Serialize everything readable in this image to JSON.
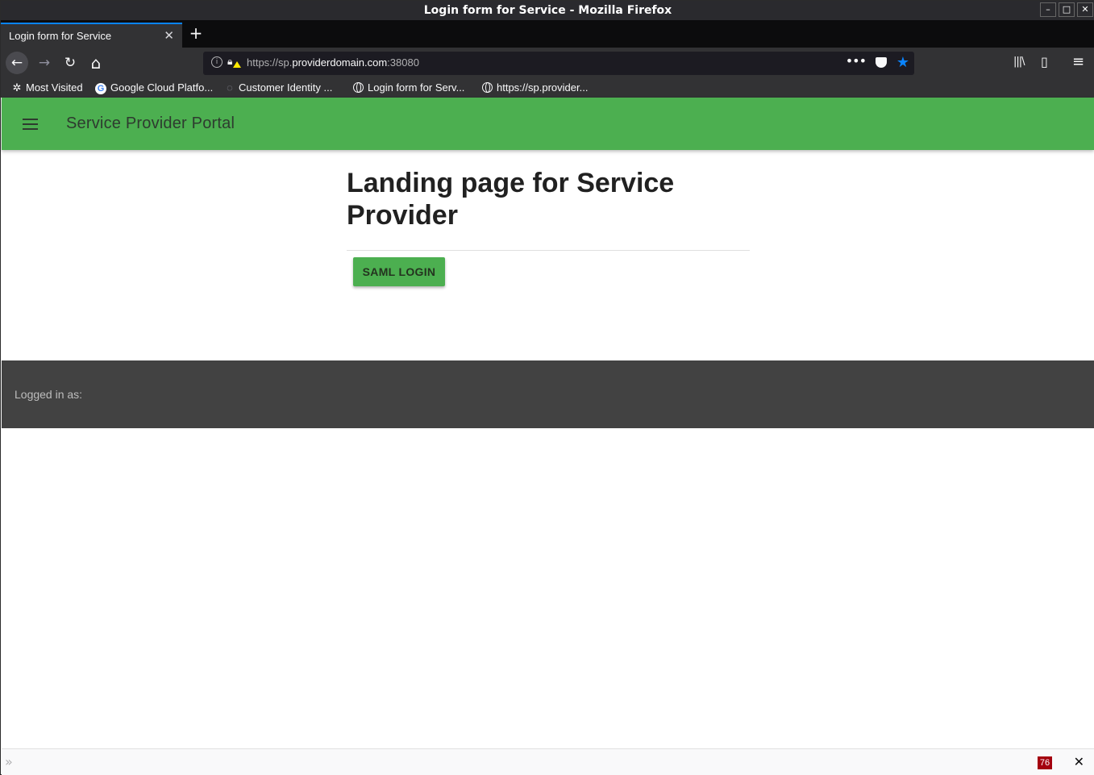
{
  "window": {
    "title": "Login form for Service - Mozilla Firefox",
    "controls": {
      "minimize": "–",
      "maximize": "□",
      "close": "✕"
    }
  },
  "tabs": [
    {
      "label": "Login form for Service",
      "close": "✕"
    }
  ],
  "new_tab": "+",
  "nav": {
    "back": "←",
    "forward": "→",
    "reload": "↻",
    "home": "⌂",
    "url_prefix": "https://sp.",
    "url_domain": "providerdomain.com",
    "url_suffix": ":38080",
    "more": "•••",
    "star": "★",
    "library": "|||\\",
    "sidebar": "▯",
    "menu": "≡"
  },
  "bookmarks": [
    {
      "label": "Most Visited",
      "icon": "gear-icon"
    },
    {
      "label": "Google Cloud Platfo...",
      "icon": "google-icon"
    },
    {
      "label": "Customer Identity ...",
      "icon": "loading-icon"
    },
    {
      "label": "Login form for Serv...",
      "icon": "globe-icon"
    },
    {
      "label": "https://sp.provider...",
      "icon": "globe-icon"
    }
  ],
  "app": {
    "title": "Service Provider Portal",
    "heading": "Landing page for Service Provider",
    "saml_button": "SAML LOGIN",
    "footer_text": "Logged in as:",
    "accent_color": "#4caf50",
    "footer_color": "#424242"
  },
  "statusbar": {
    "expand": "»",
    "badge": "76",
    "close": "✕"
  }
}
